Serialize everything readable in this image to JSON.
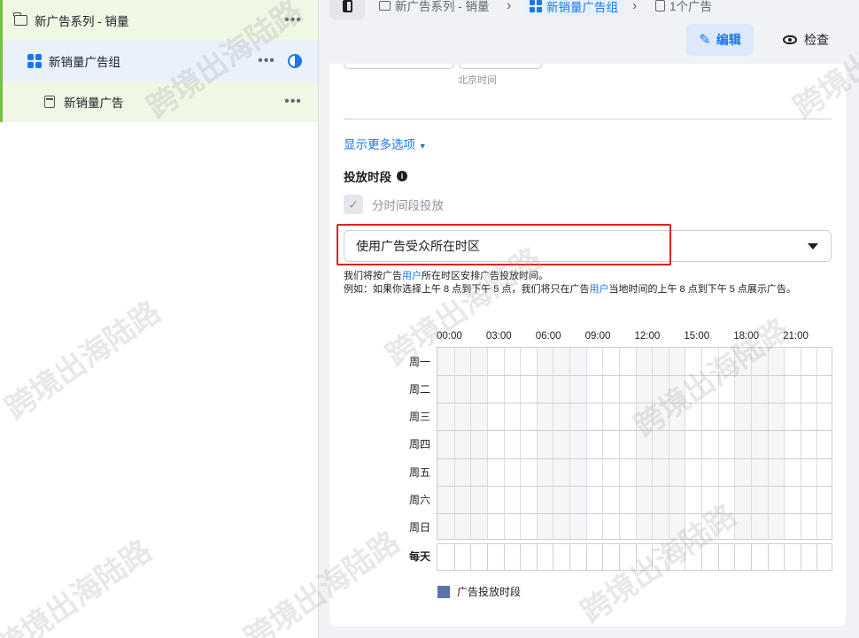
{
  "tree": {
    "campaign": {
      "label": "新广告系列 - 销量"
    },
    "adset": {
      "label": "新销量广告组"
    },
    "ad": {
      "label": "新销量广告"
    }
  },
  "breadcrumb": {
    "campaign": "新广告系列 - 销量",
    "adset": "新销量广告组",
    "ad": "1个广告"
  },
  "toolbar": {
    "edit_label": "编辑",
    "review_label": "检查"
  },
  "form": {
    "tz_note": "北京时间",
    "more_options": "显示更多选项",
    "schedule_title": "投放时段",
    "schedule_checkbox": "分时间段投放",
    "timezone_select": "使用广告受众所在时区",
    "note_1a": "我们将按广告",
    "note_1b": "用户",
    "note_1c": "所在时区安排广告投放时间。",
    "note_2a": "例如：如果你选择上午 8 点到下午 5 点，我们将只在广告",
    "note_2b": "用户",
    "note_2c": "当地时间的上午 8 点到下午 5 点展示广告。"
  },
  "schedule": {
    "hours": [
      "00:00",
      "03:00",
      "06:00",
      "09:00",
      "12:00",
      "15:00",
      "18:00",
      "21:00"
    ],
    "days": [
      "周一",
      "周二",
      "周三",
      "周四",
      "周五",
      "周六",
      "周日"
    ],
    "everyday": "每天",
    "legend": "广告投放时段"
  },
  "colors": {
    "accent": "#1877f2",
    "highlight_box": "#e02020",
    "legend_swatch": "#5b72a8"
  },
  "watermark": "跨境出海陆路"
}
